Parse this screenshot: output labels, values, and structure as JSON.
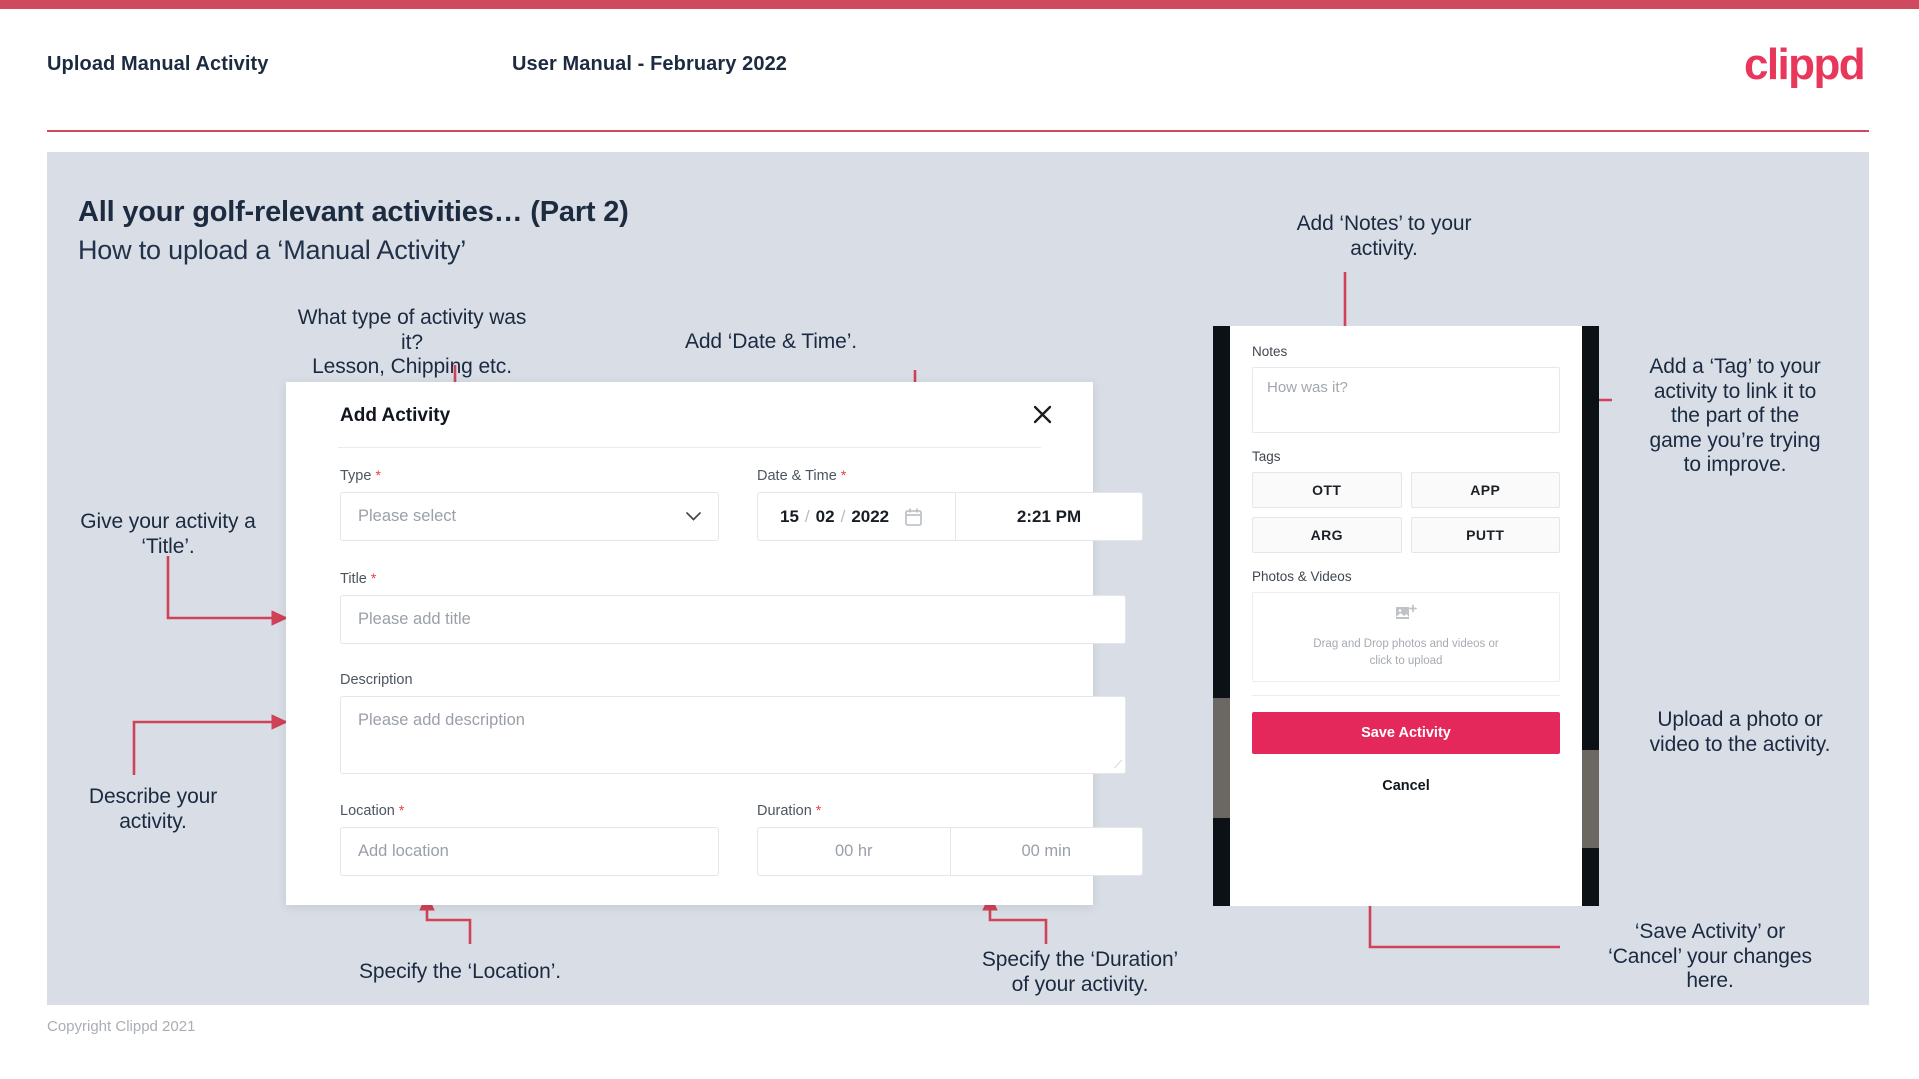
{
  "header": {
    "title": "Upload Manual Activity",
    "subtitle": "User Manual - February 2022",
    "logo": "clippd"
  },
  "slide": {
    "title": "All your golf-relevant activities… (Part 2)",
    "subtitle": "How to upload a ‘Manual Activity’"
  },
  "annotations": {
    "type": "What type of activity was it?\nLesson, Chipping etc.",
    "datetime": "Add ‘Date & Time’.",
    "title_field": "Give your activity a\n‘Title’.",
    "description": "Describe your\nactivity.",
    "location": "Specify the ‘Location’.",
    "duration": "Specify the ‘Duration’\nof your activity.",
    "notes": "Add ‘Notes’ to your\nactivity.",
    "tags": "Add a ‘Tag’ to your\nactivity to link it to\nthe part of the\ngame you’re trying\nto improve.",
    "photos": "Upload a photo or\nvideo to the activity.",
    "save_cancel": "‘Save Activity’ or\n‘Cancel’ your changes\nhere."
  },
  "dialog": {
    "title": "Add Activity",
    "close_icon": "close-icon",
    "fields": {
      "type": {
        "label": "Type",
        "required": "*",
        "placeholder": "Please select",
        "chevron": "chevron-down-icon"
      },
      "datetime": {
        "label": "Date & Time",
        "required": "*",
        "day": "15",
        "month": "02",
        "year": "2022",
        "sep": "/",
        "calendar_icon": "calendar-icon",
        "time": "2:21 PM"
      },
      "title": {
        "label": "Title",
        "required": "*",
        "placeholder": "Please add title"
      },
      "description": {
        "label": "Description",
        "required": "",
        "placeholder": "Please add description"
      },
      "location": {
        "label": "Location",
        "required": "*",
        "placeholder": "Add location"
      },
      "duration": {
        "label": "Duration",
        "required": "*",
        "hours": "00 hr",
        "minutes": "00 min"
      }
    }
  },
  "phone": {
    "notes": {
      "label": "Notes",
      "placeholder": "How was it?"
    },
    "tags": {
      "label": "Tags",
      "items": [
        "OTT",
        "APP",
        "ARG",
        "PUTT"
      ]
    },
    "photos": {
      "label": "Photos & Videos",
      "icon": "add-image-icon",
      "drop_text": "Drag and Drop photos and videos or click to upload"
    },
    "save_label": "Save Activity",
    "cancel_label": "Cancel"
  },
  "footer": {
    "copyright": "Copyright Clippd 2021"
  },
  "colors": {
    "brand_pink": "#e8375a",
    "accent_bar": "#cf4a5e",
    "save_button": "#e5285b",
    "slide_bg": "#d9dee6",
    "text_dark": "#1c2b40",
    "arrow": "#cf4257"
  }
}
